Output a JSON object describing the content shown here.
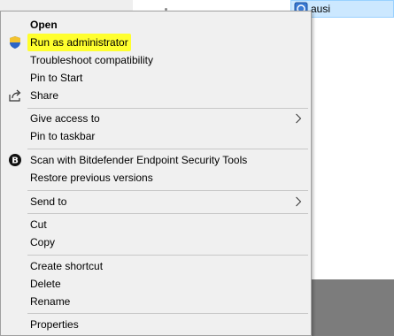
{
  "background_file": {
    "name": "ausi",
    "icon": "uac-shield-icon"
  },
  "context_menu": {
    "items": [
      {
        "label": "Open",
        "bold": true
      },
      {
        "label": "Run as administrator",
        "icon": "uac-shield-icon",
        "highlighted": true
      },
      {
        "label": "Troubleshoot compatibility"
      },
      {
        "label": "Pin to Start"
      },
      {
        "label": "Share",
        "icon": "share-icon"
      },
      {
        "label": "Give access to",
        "submenu": true
      },
      {
        "label": "Pin to taskbar"
      },
      {
        "label": "Scan with Bitdefender Endpoint Security Tools",
        "icon": "bitdefender-icon"
      },
      {
        "label": "Restore previous versions"
      },
      {
        "label": "Send to",
        "submenu": true
      },
      {
        "label": "Cut"
      },
      {
        "label": "Copy"
      },
      {
        "label": "Create shortcut"
      },
      {
        "label": "Delete"
      },
      {
        "label": "Rename"
      },
      {
        "label": "Properties"
      }
    ]
  },
  "colors": {
    "menu_background": "#f0f0f0",
    "highlight": "#ffff2e",
    "selected_file": "#cce8ff"
  }
}
